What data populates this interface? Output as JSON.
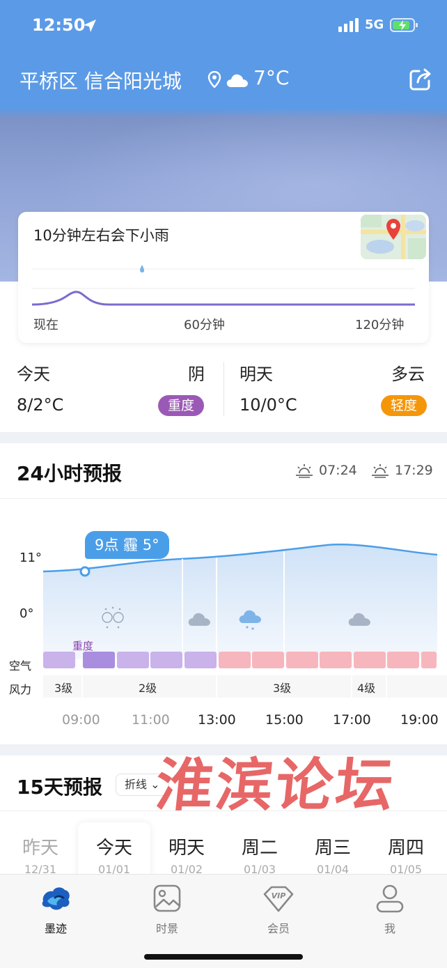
{
  "status_bar": {
    "time": "12:50",
    "network": "5G"
  },
  "header": {
    "location": "平桥区 信合阳光城",
    "temperature": "7°C"
  },
  "rain_card": {
    "title": "10分钟左右会下小雨",
    "axis": [
      "现在",
      "60分钟",
      "120分钟"
    ]
  },
  "summary": {
    "today": {
      "label": "今天",
      "condition": "阴",
      "temp": "8/2°C",
      "aqi": "重度",
      "aqi_color": "#9b59b6"
    },
    "tomorrow": {
      "label": "明天",
      "condition": "多云",
      "temp": "10/0°C",
      "aqi": "轻度",
      "aqi_color": "#f5960a"
    }
  },
  "forecast24": {
    "title": "24小时预报",
    "sunrise": "07:24",
    "sunset": "17:29",
    "y_labels": [
      "11°",
      "0°"
    ],
    "tooltip": "9点 霾 5°",
    "aqi_note": "重度",
    "row_labels": {
      "air": "空气",
      "wind": "风力"
    },
    "wind": [
      "3级",
      "2级",
      "3级",
      "4级"
    ],
    "hours": [
      "09:00",
      "11:00",
      "13:00",
      "15:00",
      "17:00",
      "19:00"
    ],
    "icons": [
      "haze-icon",
      "cloud-icon",
      "snow-cloud-icon",
      "cloud-icon"
    ],
    "air_colors": [
      "#c9b3ea",
      "#a98ee0",
      "#f7b6bd"
    ]
  },
  "forecast15": {
    "title": "15天预报",
    "style_label": "折线",
    "days": [
      {
        "name": "昨天",
        "date": "12/31"
      },
      {
        "name": "今天",
        "date": "01/01"
      },
      {
        "name": "明天",
        "date": "01/02"
      },
      {
        "name": "周二",
        "date": "01/03"
      },
      {
        "name": "周三",
        "date": "01/04"
      },
      {
        "name": "周四",
        "date": "01/05"
      }
    ]
  },
  "watermark": "淮滨论坛",
  "tabs": [
    {
      "label": "墨迹",
      "icon": "moji-logo-icon",
      "active": true
    },
    {
      "label": "时景",
      "icon": "image-icon",
      "active": false
    },
    {
      "label": "会员",
      "icon": "vip-icon",
      "active": false
    },
    {
      "label": "我",
      "icon": "profile-icon",
      "active": false
    }
  ]
}
